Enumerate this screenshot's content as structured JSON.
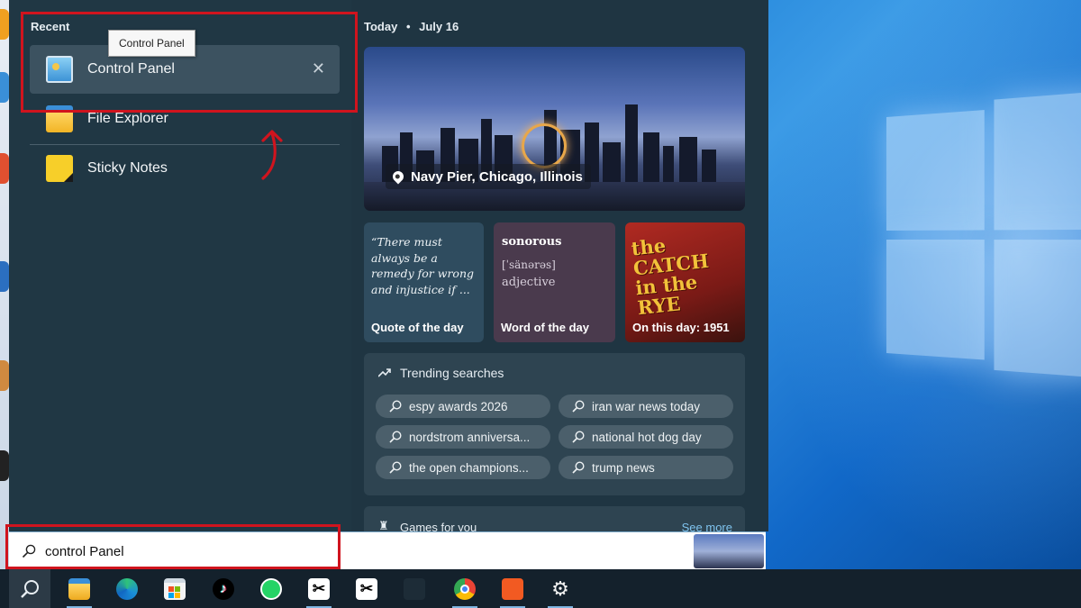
{
  "recent": {
    "title": "Recent",
    "tooltip": "Control Panel",
    "items": [
      {
        "label": "Control Panel",
        "icon": "control-panel-icon"
      },
      {
        "label": "File Explorer",
        "icon": "folder-icon"
      },
      {
        "label": "Sticky Notes",
        "icon": "sticky-notes-icon"
      }
    ],
    "close_glyph": "✕"
  },
  "today": {
    "label": "Today",
    "separator": "•",
    "date": "July 16"
  },
  "hero": {
    "caption": "Navy Pier, Chicago, Illinois"
  },
  "cards": {
    "quote": {
      "text": "“There must always be a remedy for wrong and injustice if ...",
      "footer": "Quote of the day"
    },
    "word": {
      "word": "sonorous",
      "pronunciation": "[ˈsänərəs]",
      "part_of_speech": "adjective",
      "footer": "Word of the day"
    },
    "history": {
      "image_text": "the CATCHER in the RYE",
      "footer": "On this day: 1951"
    }
  },
  "trending": {
    "title": "Trending searches",
    "items": [
      "espy awards 2026",
      "iran war news today",
      "nordstrom anniversa...",
      "national hot dog day",
      "the open champions...",
      "trump news"
    ]
  },
  "games": {
    "title": "Games for you",
    "more": "See more"
  },
  "search": {
    "value": "control Panel"
  },
  "taskbar": {
    "items": [
      "search-icon",
      "file-explorer-icon",
      "edge-icon",
      "store-icon",
      "tiktok-icon",
      "whatsapp-icon",
      "capcut-icon",
      "capcut-icon",
      "chrome-icon",
      "reader-icon",
      "settings-icon"
    ]
  },
  "colors": {
    "highlight": "#d0141e",
    "panel": "#1f3542",
    "accent": "#7fc3ee"
  }
}
